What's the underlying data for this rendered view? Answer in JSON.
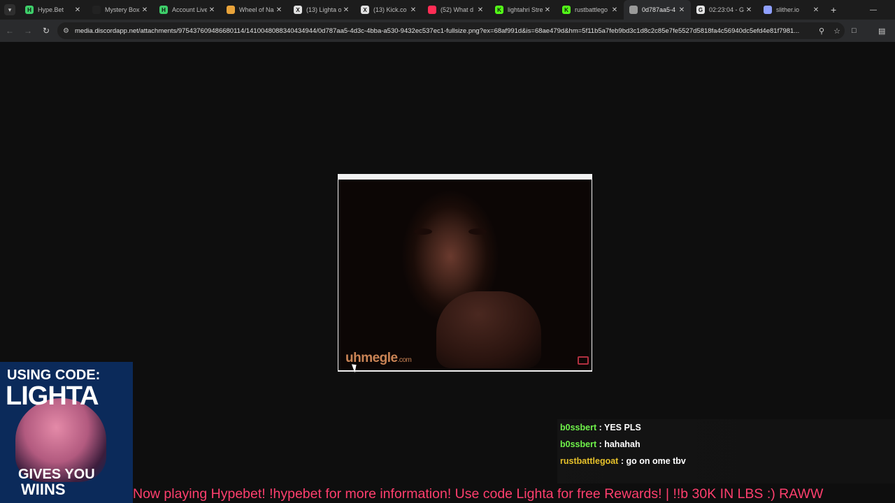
{
  "browser": {
    "tabs": [
      {
        "title": "Hype.Bet",
        "favicon_color": "#3ecf6a",
        "favicon_glyph": "H",
        "active": false
      },
      {
        "title": "Mystery Box",
        "favicon_color": "#222222",
        "favicon_glyph": "",
        "active": false
      },
      {
        "title": "Account Live",
        "favicon_color": "#3ecf6a",
        "favicon_glyph": "H",
        "active": false
      },
      {
        "title": "Wheel of Na",
        "favicon_color": "#e8a33a",
        "favicon_glyph": "",
        "active": false
      },
      {
        "title": "(13) Lighta o",
        "favicon_color": "#e0e0e0",
        "favicon_glyph": "X",
        "active": false
      },
      {
        "title": "(13) Kick.co",
        "favicon_color": "#e0e0e0",
        "favicon_glyph": "X",
        "active": false
      },
      {
        "title": "(52) What d",
        "favicon_color": "#ff2d55",
        "favicon_glyph": "",
        "active": false
      },
      {
        "title": "lightahri Stre",
        "favicon_color": "#53fc18",
        "favicon_glyph": "K",
        "active": false
      },
      {
        "title": "rustbattlego",
        "favicon_color": "#53fc18",
        "favicon_glyph": "K",
        "active": false
      },
      {
        "title": "0d787aa5-4",
        "favicon_color": "#9a9a9a",
        "favicon_glyph": "",
        "active": true
      },
      {
        "title": "02:23:04 - G",
        "favicon_color": "#e6e6e6",
        "favicon_glyph": "G",
        "active": false
      },
      {
        "title": "slither.io",
        "favicon_color": "#8fa0ff",
        "favicon_glyph": "",
        "active": false
      }
    ],
    "new_tab_label": "+",
    "url": "media.discordapp.net/attachments/975437609486680114/1410048088340434944/0d787aa5-4d3c-4bba-a530-9432ec537ec1-fullsize.png?ex=68af991d&is=68ae479d&hm=5f11b5a7feb9bd3c1d8c2c85e7fe5527d5818fa4c56940dc5efd4e81f7981..."
  },
  "image": {
    "watermark": "uhmegle",
    "watermark_suffix": ".com"
  },
  "promo": {
    "line1": "USING CODE:",
    "line2": "LIGHTA",
    "line3": "GIVES YOU",
    "line4": "WIINS"
  },
  "chat": {
    "messages": [
      {
        "user": "b0ssbert",
        "text": "YES PLS",
        "user_color": "#6ff24a"
      },
      {
        "user": "b0ssbert",
        "text": "hahahah",
        "user_color": "#6ff24a"
      },
      {
        "user": "rustbattlegoat",
        "text": "go on ome tbv",
        "user_color": "#e6c12a"
      }
    ]
  },
  "ticker": {
    "text": "Now playing Hypebet! !hypebet  for more information! Use code Lighta for free Rewards! | !!b 30K IN LBS :) RAWW"
  }
}
